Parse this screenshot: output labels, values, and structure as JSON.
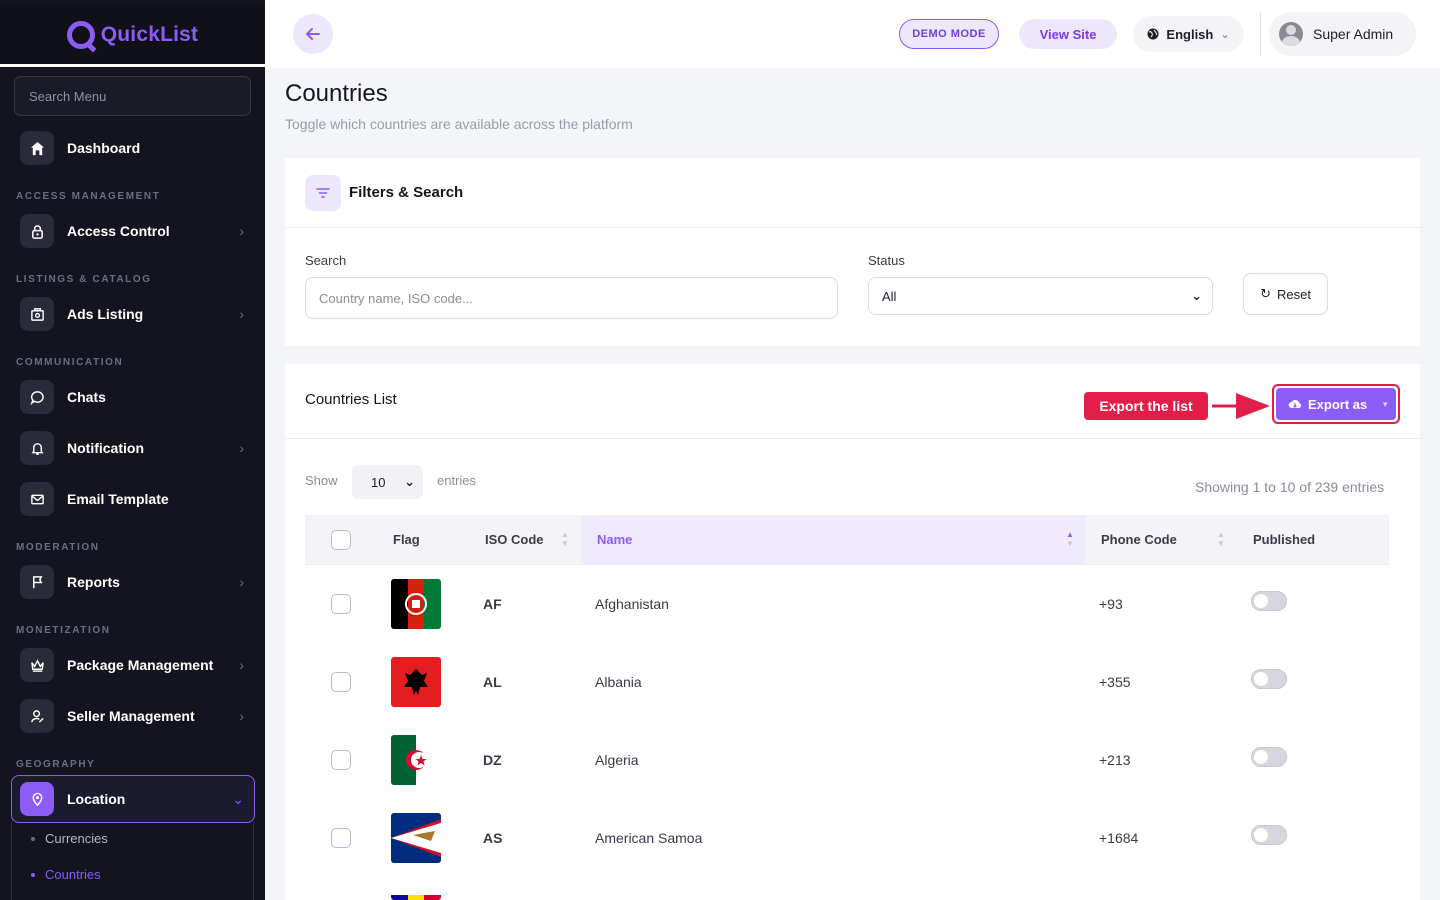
{
  "app": {
    "name": "QuickList"
  },
  "sidebar": {
    "search_placeholder": "Search Menu",
    "sections": {
      "access": "ACCESS MANAGEMENT",
      "listings": "LISTINGS & CATALOG",
      "communication": "COMMUNICATION",
      "moderation": "MODERATION",
      "monetization": "MONETIZATION",
      "geography": "GEOGRAPHY"
    },
    "items": {
      "dashboard": "Dashboard",
      "access_control": "Access Control",
      "ads_listing": "Ads Listing",
      "chats": "Chats",
      "notification": "Notification",
      "email_template": "Email Template",
      "reports": "Reports",
      "package_management": "Package Management",
      "seller_management": "Seller Management",
      "location": "Location"
    },
    "location_sub": {
      "currencies": "Currencies",
      "countries": "Countries"
    },
    "active_color": "#8b5cf6"
  },
  "topbar": {
    "demo": "DEMO MODE",
    "view_site": "View Site",
    "language": "English",
    "user": "Super Admin"
  },
  "page": {
    "title": "Countries",
    "subtitle": "Toggle which countries are available across the platform"
  },
  "filters": {
    "title": "Filters & Search",
    "search_label": "Search",
    "search_placeholder": "Country name, ISO code...",
    "status_label": "Status",
    "status_value": "All",
    "reset": "Reset"
  },
  "list": {
    "title": "Countries List",
    "callout": "Export the list",
    "export": "Export as",
    "show": "Show",
    "entries_value": "10",
    "entries": "entries",
    "showing": "Showing 1 to 10 of 239 entries",
    "columns": {
      "flag": "Flag",
      "iso": "ISO Code",
      "name": "Name",
      "phone": "Phone Code",
      "published": "Published"
    },
    "rows": [
      {
        "iso": "AF",
        "name": "Afghanistan",
        "phone": "+93",
        "published": false
      },
      {
        "iso": "AL",
        "name": "Albania",
        "phone": "+355",
        "published": false
      },
      {
        "iso": "DZ",
        "name": "Algeria",
        "phone": "+213",
        "published": false
      },
      {
        "iso": "AS",
        "name": "American Samoa",
        "phone": "+1684",
        "published": false
      }
    ]
  }
}
